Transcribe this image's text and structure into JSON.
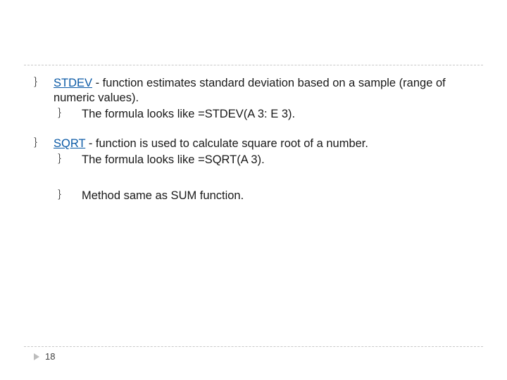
{
  "colors": {
    "link": "#0b5aa6"
  },
  "bullets": {
    "stdev": {
      "name": "STDEV",
      "desc": " - function estimates standard deviation based on a sample (range of numeric values).",
      "sub1": "The formula looks like =STDEV(A 3: E 3)."
    },
    "sqrt": {
      "name": "SQRT",
      "desc": " - function is used to calculate square root of a number.",
      "sub1": "The formula looks like =SQRT(A 3).",
      "sub2": "Method same as SUM function."
    }
  },
  "glyph": "｝",
  "footer": {
    "page": "18"
  }
}
